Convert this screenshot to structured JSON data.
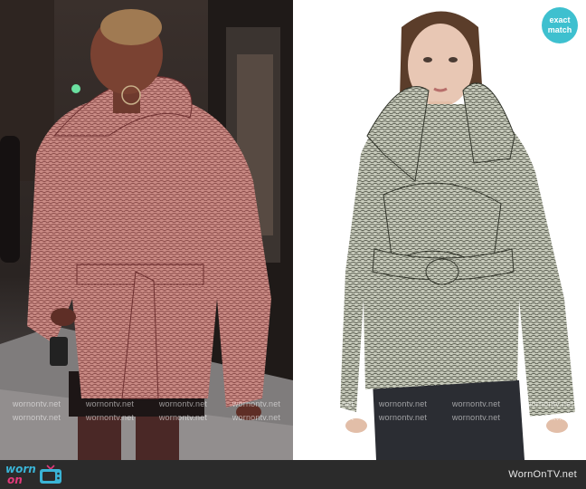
{
  "photos": [
    {
      "name": "left-photo",
      "subject": "woman in patterned puffer jacket on a city street at night"
    },
    {
      "name": "right-photo",
      "subject": "model in snakeskin print puffer jacket on white background"
    }
  ],
  "badge": {
    "line1": "exact",
    "line2": "match",
    "color": "#3ec0cf"
  },
  "watermark": {
    "text": "wornontv.net"
  },
  "footer": {
    "logo_top": "worn",
    "logo_bottom": "on",
    "logo_icon": "tv-icon",
    "site": "WornOnTV.net",
    "background": "#2b2b2b",
    "logo_top_color": "#3ab4d6",
    "logo_bottom_color": "#e2397a"
  },
  "colors": {
    "jacket_pink": "#c98a84",
    "jacket_silver": "#b9bdae"
  }
}
